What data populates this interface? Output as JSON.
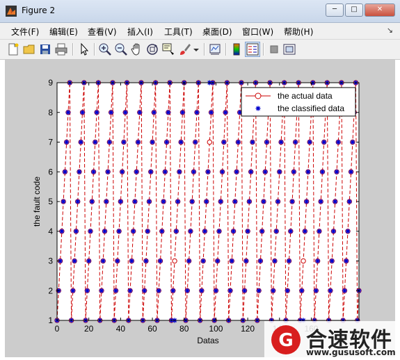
{
  "window": {
    "title": "Figure 2",
    "minimize": "0",
    "maximize": "1",
    "close": "r"
  },
  "menu": [
    "文件(F)",
    "编辑(E)",
    "查看(V)",
    "插入(I)",
    "工具(T)",
    "桌面(D)",
    "窗口(W)",
    "帮助(H)"
  ],
  "menu_corner": "↘",
  "toolbar": [
    "new-figure-icon",
    "open-folder-icon",
    "save-icon",
    "print-icon",
    "pointer-icon",
    "zoom-in-icon",
    "zoom-out-icon",
    "pan-hand-icon",
    "rotate-3d-icon",
    "data-cursor-icon",
    "brush-icon",
    "brush-dropdown-icon",
    "link-plot-icon",
    "colorbar-icon",
    "legend-icon",
    "hide-plot-tools-icon",
    "show-plot-tools-icon"
  ],
  "watermark": {
    "logo_letter": "G",
    "name": "合速软件",
    "url": "www.gususoft.com"
  },
  "colors": {
    "actual": "#cc0000",
    "classified": "#0000cc",
    "figure_bg": "#cccccc"
  },
  "chart_data": {
    "type": "line",
    "xlabel": "Datas",
    "ylabel": "the fault code",
    "xlim": [
      0,
      190
    ],
    "ylim": [
      1,
      9
    ],
    "xticks": [
      0,
      20,
      40,
      60,
      80,
      100,
      120,
      140,
      160
    ],
    "yticks": [
      1,
      2,
      3,
      4,
      5,
      6,
      7,
      8,
      9
    ],
    "legend_position": "top-right",
    "series": [
      {
        "name": "the actual data",
        "style": "line-circle"
      },
      {
        "name": "the classified data",
        "style": "star"
      }
    ],
    "x": [
      0,
      1,
      2,
      3,
      4,
      5,
      6,
      7,
      8,
      9,
      10,
      11,
      12,
      13,
      14,
      15,
      16,
      17,
      18,
      19,
      20,
      21,
      22,
      23,
      24,
      25,
      26,
      27,
      28,
      29,
      30,
      31,
      32,
      33,
      34,
      35,
      36,
      37,
      38,
      39,
      40,
      41,
      42,
      43,
      44,
      45,
      46,
      47,
      48,
      49,
      50,
      51,
      52,
      53,
      54,
      55,
      56,
      57,
      58,
      59,
      60,
      61,
      62,
      63,
      64,
      65,
      66,
      67,
      68,
      69,
      70,
      71,
      72,
      73,
      74,
      75,
      76,
      77,
      78,
      79,
      80,
      81,
      82,
      83,
      84,
      85,
      86,
      87,
      88,
      89,
      90,
      91,
      92,
      93,
      94,
      95,
      96,
      97,
      98,
      99,
      100,
      101,
      102,
      103,
      104,
      105,
      106,
      107,
      108,
      109,
      110,
      111,
      112,
      113,
      114,
      115,
      116,
      117,
      118,
      119,
      120,
      121,
      122,
      123,
      124,
      125,
      126,
      127,
      128,
      129,
      130,
      131,
      132,
      133,
      134,
      135,
      136,
      137,
      138,
      139,
      140,
      141,
      142,
      143,
      144,
      145,
      146,
      147,
      148,
      149,
      150,
      151,
      152,
      153,
      154,
      155,
      156,
      157,
      158,
      159,
      160,
      161,
      162,
      163,
      164,
      165,
      166,
      167,
      168,
      169,
      170,
      171,
      172,
      173,
      174,
      175,
      176,
      177,
      178,
      179,
      180,
      181,
      182,
      183,
      184,
      185,
      186,
      187,
      188,
      189,
      190
    ],
    "actual": [
      1,
      2,
      3,
      4,
      5,
      6,
      7,
      8,
      9,
      1,
      2,
      3,
      4,
      5,
      6,
      7,
      8,
      9,
      1,
      2,
      3,
      4,
      5,
      6,
      7,
      8,
      9,
      1,
      2,
      3,
      4,
      5,
      6,
      7,
      8,
      9,
      1,
      2,
      3,
      4,
      5,
      6,
      7,
      8,
      9,
      1,
      2,
      3,
      4,
      5,
      6,
      7,
      8,
      9,
      1,
      2,
      3,
      4,
      5,
      6,
      7,
      8,
      9,
      1,
      2,
      3,
      4,
      5,
      6,
      7,
      8,
      9,
      1,
      2,
      3,
      4,
      5,
      6,
      7,
      8,
      9,
      1,
      2,
      3,
      4,
      5,
      6,
      7,
      8,
      9,
      1,
      2,
      3,
      4,
      5,
      6,
      7,
      8,
      9,
      1,
      2,
      3,
      4,
      5,
      6,
      7,
      8,
      9,
      1,
      2,
      3,
      4,
      5,
      6,
      7,
      8,
      9,
      1,
      2,
      3,
      4,
      5,
      6,
      7,
      8,
      9,
      1,
      2,
      3,
      4,
      5,
      6,
      7,
      8,
      9,
      1,
      2,
      3,
      4,
      5,
      6,
      7,
      8,
      9,
      1,
      2,
      3,
      4,
      5,
      6,
      7,
      8,
      9,
      1,
      2,
      3,
      4,
      5,
      6,
      7,
      8,
      9,
      1,
      2,
      3,
      4,
      5,
      6,
      7,
      8,
      9,
      1,
      2,
      3,
      4,
      5,
      6,
      7,
      8,
      9,
      1,
      2,
      3,
      4,
      5,
      6,
      7,
      8,
      9,
      1,
      2,
      3,
      4,
      5,
      6,
      7,
      8,
      9,
      1,
      2,
      3
    ],
    "classified": [
      1,
      2,
      3,
      4,
      5,
      6,
      7,
      8,
      9,
      1,
      2,
      3,
      4,
      5,
      6,
      7,
      8,
      9,
      1,
      2,
      3,
      4,
      5,
      6,
      7,
      8,
      9,
      1,
      2,
      3,
      4,
      5,
      6,
      7,
      8,
      9,
      1,
      2,
      3,
      4,
      5,
      6,
      7,
      8,
      9,
      1,
      2,
      3,
      4,
      5,
      6,
      7,
      8,
      9,
      1,
      2,
      3,
      4,
      5,
      6,
      7,
      8,
      9,
      1,
      2,
      3,
      4,
      5,
      6,
      7,
      8,
      9,
      1,
      2,
      1,
      4,
      5,
      6,
      7,
      8,
      9,
      1,
      2,
      3,
      4,
      5,
      6,
      7,
      8,
      9,
      1,
      2,
      3,
      4,
      5,
      6,
      9,
      8,
      9,
      1,
      2,
      3,
      4,
      5,
      6,
      7,
      8,
      9,
      1,
      2,
      3,
      4,
      5,
      6,
      7,
      8,
      9,
      1,
      2,
      3,
      4,
      5,
      6,
      7,
      8,
      9,
      1,
      2,
      3,
      4,
      5,
      6,
      7,
      8,
      9,
      1,
      2,
      3,
      4,
      5,
      6,
      7,
      8,
      9,
      1,
      2,
      3,
      4,
      5,
      6,
      7,
      8,
      9,
      1,
      2,
      1,
      4,
      5,
      6,
      7,
      8,
      9,
      1,
      2,
      3,
      4,
      5,
      6,
      7,
      8,
      9,
      1,
      2,
      3,
      4,
      5,
      6,
      7,
      8,
      9,
      1,
      2,
      3,
      4,
      5,
      6,
      7,
      8,
      9,
      1,
      2,
      3,
      4,
      5,
      6,
      7,
      8,
      9,
      1,
      2,
      3
    ]
  }
}
